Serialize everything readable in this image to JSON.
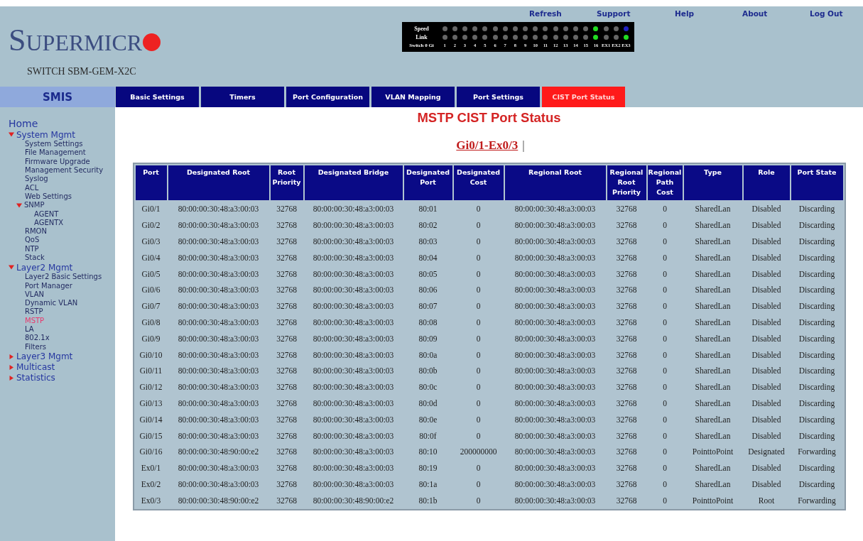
{
  "top_links": [
    "Refresh",
    "Support",
    "Help",
    "About",
    "Log Out"
  ],
  "logo": {
    "text": "SUPERMICR"
  },
  "device_name": "SWITCH SBM-GEM-X2C",
  "led_panel": {
    "rows": [
      {
        "label": "Speed",
        "leds": [
          {
            "color": "#666666"
          },
          {
            "color": "#666666"
          },
          {
            "color": "#666666"
          },
          {
            "color": "#666666"
          },
          {
            "color": "#666666"
          },
          {
            "color": "#666666"
          },
          {
            "color": "#666666"
          },
          {
            "color": "#666666"
          },
          {
            "color": "#666666"
          },
          {
            "color": "#666666"
          },
          {
            "color": "#666666"
          },
          {
            "color": "#666666"
          },
          {
            "color": "#666666"
          },
          {
            "color": "#666666"
          },
          {
            "color": "#666666"
          },
          {
            "color": "#22dd22"
          },
          {
            "color": "#666666"
          },
          {
            "color": "#666666"
          },
          {
            "color": "#2020c0"
          }
        ]
      },
      {
        "label": "Link",
        "leds": [
          {
            "color": "#666666"
          },
          {
            "color": "#666666"
          },
          {
            "color": "#666666"
          },
          {
            "color": "#666666"
          },
          {
            "color": "#666666"
          },
          {
            "color": "#666666"
          },
          {
            "color": "#666666"
          },
          {
            "color": "#666666"
          },
          {
            "color": "#666666"
          },
          {
            "color": "#666666"
          },
          {
            "color": "#666666"
          },
          {
            "color": "#666666"
          },
          {
            "color": "#666666"
          },
          {
            "color": "#666666"
          },
          {
            "color": "#666666"
          },
          {
            "color": "#22dd22"
          },
          {
            "color": "#666666"
          },
          {
            "color": "#666666"
          },
          {
            "color": "#22dd22"
          }
        ]
      }
    ],
    "port_row_label": "Switch 0 Gi",
    "ports": [
      "1",
      "2",
      "3",
      "4",
      "5",
      "6",
      "7",
      "8",
      "9",
      "10",
      "11",
      "12",
      "13",
      "14",
      "15",
      "16",
      "EX1",
      "EX2",
      "EX3"
    ]
  },
  "product": "SMIS",
  "tabs": [
    {
      "label": "Basic Settings",
      "selected": false
    },
    {
      "label": "Timers",
      "selected": false
    },
    {
      "label": "Port Configuration",
      "selected": false
    },
    {
      "label": "VLAN Mapping",
      "selected": false
    },
    {
      "label": "Port Settings",
      "selected": false
    },
    {
      "label": "CIST Port Status",
      "selected": true
    }
  ],
  "sidebar": {
    "items": [
      {
        "kind": "page",
        "label": "Home",
        "selected": false
      },
      {
        "kind": "folder",
        "label": "System Mgmt",
        "expanded": true,
        "selected": false,
        "children": [
          {
            "kind": "page",
            "label": "System Settings",
            "selected": false
          },
          {
            "kind": "page",
            "label": "File Management",
            "selected": false
          },
          {
            "kind": "page",
            "label": "Firmware Upgrade",
            "selected": false
          },
          {
            "kind": "page",
            "label": "Management Security",
            "selected": false
          },
          {
            "kind": "page",
            "label": "Syslog",
            "selected": false
          },
          {
            "kind": "page",
            "label": "ACL",
            "selected": false
          },
          {
            "kind": "page",
            "label": "Web Settings",
            "selected": false
          },
          {
            "kind": "folder",
            "label": "SNMP",
            "expanded": true,
            "selected": false,
            "children": [
              {
                "kind": "page",
                "label": "AGENT",
                "selected": false
              },
              {
                "kind": "page",
                "label": "AGENTX",
                "selected": false
              }
            ]
          },
          {
            "kind": "page",
            "label": "RMON",
            "selected": false
          },
          {
            "kind": "page",
            "label": "QoS",
            "selected": false
          },
          {
            "kind": "page",
            "label": "NTP",
            "selected": false
          },
          {
            "kind": "page",
            "label": "Stack",
            "selected": false
          }
        ]
      },
      {
        "kind": "folder",
        "label": "Layer2 Mgmt",
        "expanded": true,
        "selected": false,
        "children": [
          {
            "kind": "page",
            "label": "Layer2 Basic Settings",
            "selected": false
          },
          {
            "kind": "page",
            "label": "Port Manager",
            "selected": false
          },
          {
            "kind": "page",
            "label": "VLAN",
            "selected": false
          },
          {
            "kind": "page",
            "label": "Dynamic VLAN",
            "selected": false
          },
          {
            "kind": "page",
            "label": "RSTP",
            "selected": false
          },
          {
            "kind": "page",
            "label": "MSTP",
            "selected": true
          },
          {
            "kind": "page",
            "label": "LA",
            "selected": false
          },
          {
            "kind": "page",
            "label": "802.1x",
            "selected": false
          },
          {
            "kind": "page",
            "label": "Filters",
            "selected": false
          }
        ]
      },
      {
        "kind": "folder",
        "label": "Layer3 Mgmt",
        "expanded": false,
        "selected": false
      },
      {
        "kind": "folder",
        "label": "Multicast",
        "expanded": false,
        "selected": false
      },
      {
        "kind": "folder",
        "label": "Statistics",
        "expanded": false,
        "selected": false
      }
    ]
  },
  "page_title": "MSTP CIST Port Status",
  "range_links": {
    "label": "Gi0/1-Ex0/3",
    "separator": "|"
  },
  "table": {
    "columns": [
      "Port",
      "Designated Root",
      "Root Priority",
      "Designated Bridge",
      "Designated Port",
      "Designated Cost",
      "Regional Root",
      "Regional Root Priority",
      "Regional Path Cost",
      "Type",
      "Role",
      "Port State"
    ],
    "rows": [
      [
        "Gi0/1",
        "80:00:00:30:48:a3:00:03",
        "32768",
        "80:00:00:30:48:a3:00:03",
        "80:01",
        "0",
        "80:00:00:30:48:a3:00:03",
        "32768",
        "0",
        "SharedLan",
        "Disabled",
        "Discarding"
      ],
      [
        "Gi0/2",
        "80:00:00:30:48:a3:00:03",
        "32768",
        "80:00:00:30:48:a3:00:03",
        "80:02",
        "0",
        "80:00:00:30:48:a3:00:03",
        "32768",
        "0",
        "SharedLan",
        "Disabled",
        "Discarding"
      ],
      [
        "Gi0/3",
        "80:00:00:30:48:a3:00:03",
        "32768",
        "80:00:00:30:48:a3:00:03",
        "80:03",
        "0",
        "80:00:00:30:48:a3:00:03",
        "32768",
        "0",
        "SharedLan",
        "Disabled",
        "Discarding"
      ],
      [
        "Gi0/4",
        "80:00:00:30:48:a3:00:03",
        "32768",
        "80:00:00:30:48:a3:00:03",
        "80:04",
        "0",
        "80:00:00:30:48:a3:00:03",
        "32768",
        "0",
        "SharedLan",
        "Disabled",
        "Discarding"
      ],
      [
        "Gi0/5",
        "80:00:00:30:48:a3:00:03",
        "32768",
        "80:00:00:30:48:a3:00:03",
        "80:05",
        "0",
        "80:00:00:30:48:a3:00:03",
        "32768",
        "0",
        "SharedLan",
        "Disabled",
        "Discarding"
      ],
      [
        "Gi0/6",
        "80:00:00:30:48:a3:00:03",
        "32768",
        "80:00:00:30:48:a3:00:03",
        "80:06",
        "0",
        "80:00:00:30:48:a3:00:03",
        "32768",
        "0",
        "SharedLan",
        "Disabled",
        "Discarding"
      ],
      [
        "Gi0/7",
        "80:00:00:30:48:a3:00:03",
        "32768",
        "80:00:00:30:48:a3:00:03",
        "80:07",
        "0",
        "80:00:00:30:48:a3:00:03",
        "32768",
        "0",
        "SharedLan",
        "Disabled",
        "Discarding"
      ],
      [
        "Gi0/8",
        "80:00:00:30:48:a3:00:03",
        "32768",
        "80:00:00:30:48:a3:00:03",
        "80:08",
        "0",
        "80:00:00:30:48:a3:00:03",
        "32768",
        "0",
        "SharedLan",
        "Disabled",
        "Discarding"
      ],
      [
        "Gi0/9",
        "80:00:00:30:48:a3:00:03",
        "32768",
        "80:00:00:30:48:a3:00:03",
        "80:09",
        "0",
        "80:00:00:30:48:a3:00:03",
        "32768",
        "0",
        "SharedLan",
        "Disabled",
        "Discarding"
      ],
      [
        "Gi0/10",
        "80:00:00:30:48:a3:00:03",
        "32768",
        "80:00:00:30:48:a3:00:03",
        "80:0a",
        "0",
        "80:00:00:30:48:a3:00:03",
        "32768",
        "0",
        "SharedLan",
        "Disabled",
        "Discarding"
      ],
      [
        "Gi0/11",
        "80:00:00:30:48:a3:00:03",
        "32768",
        "80:00:00:30:48:a3:00:03",
        "80:0b",
        "0",
        "80:00:00:30:48:a3:00:03",
        "32768",
        "0",
        "SharedLan",
        "Disabled",
        "Discarding"
      ],
      [
        "Gi0/12",
        "80:00:00:30:48:a3:00:03",
        "32768",
        "80:00:00:30:48:a3:00:03",
        "80:0c",
        "0",
        "80:00:00:30:48:a3:00:03",
        "32768",
        "0",
        "SharedLan",
        "Disabled",
        "Discarding"
      ],
      [
        "Gi0/13",
        "80:00:00:30:48:a3:00:03",
        "32768",
        "80:00:00:30:48:a3:00:03",
        "80:0d",
        "0",
        "80:00:00:30:48:a3:00:03",
        "32768",
        "0",
        "SharedLan",
        "Disabled",
        "Discarding"
      ],
      [
        "Gi0/14",
        "80:00:00:30:48:a3:00:03",
        "32768",
        "80:00:00:30:48:a3:00:03",
        "80:0e",
        "0",
        "80:00:00:30:48:a3:00:03",
        "32768",
        "0",
        "SharedLan",
        "Disabled",
        "Discarding"
      ],
      [
        "Gi0/15",
        "80:00:00:30:48:a3:00:03",
        "32768",
        "80:00:00:30:48:a3:00:03",
        "80:0f",
        "0",
        "80:00:00:30:48:a3:00:03",
        "32768",
        "0",
        "SharedLan",
        "Disabled",
        "Discarding"
      ],
      [
        "Gi0/16",
        "80:00:00:30:48:90:00:e2",
        "32768",
        "80:00:00:30:48:a3:00:03",
        "80:10",
        "200000000",
        "80:00:00:30:48:a3:00:03",
        "32768",
        "0",
        "PointtoPoint",
        "Designated",
        "Forwarding"
      ],
      [
        "Ex0/1",
        "80:00:00:30:48:a3:00:03",
        "32768",
        "80:00:00:30:48:a3:00:03",
        "80:19",
        "0",
        "80:00:00:30:48:a3:00:03",
        "32768",
        "0",
        "SharedLan",
        "Disabled",
        "Discarding"
      ],
      [
        "Ex0/2",
        "80:00:00:30:48:a3:00:03",
        "32768",
        "80:00:00:30:48:a3:00:03",
        "80:1a",
        "0",
        "80:00:00:30:48:a3:00:03",
        "32768",
        "0",
        "SharedLan",
        "Disabled",
        "Discarding"
      ],
      [
        "Ex0/3",
        "80:00:00:30:48:90:00:e2",
        "32768",
        "80:00:00:30:48:90:00:e2",
        "80:1b",
        "0",
        "80:00:00:30:48:a3:00:03",
        "32768",
        "0",
        "PointtoPoint",
        "Root",
        "Forwarding"
      ]
    ]
  }
}
